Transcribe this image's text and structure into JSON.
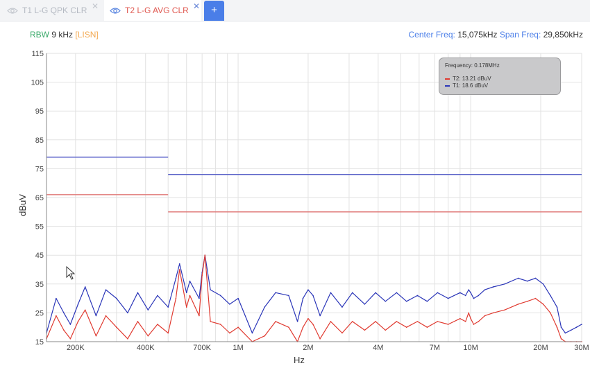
{
  "tabs": [
    {
      "label": "T1 L-G QPK CLR",
      "active": false
    },
    {
      "label": "T2 L-G AVG CLR",
      "active": true
    }
  ],
  "add_tab_label": "+",
  "close_glyph": "✕",
  "header": {
    "rbw_label": "RBW",
    "rbw_value": "9 kHz",
    "lisn_open": "[",
    "lisn_label": "LISN",
    "lisn_close": "]",
    "center_label": "Center Freq:",
    "center_value": "15,075kHz",
    "span_label": "Span Freq:",
    "span_value": "29,850kHz"
  },
  "legend": {
    "frequency_label": "Frequency: 0.178MHz",
    "entries": [
      {
        "label": "T2: 13.21 dBuV",
        "color": "#e03a30"
      },
      {
        "label": "T1: 18.6 dBuV",
        "color": "#2a35b8"
      }
    ]
  },
  "colors": {
    "t1": "#2a35b8",
    "t2": "#e03a30",
    "limit_t1": "#5a62c8",
    "limit_t2": "#e07a78",
    "accent": "#4a7ee8",
    "grid": "#e2e2e2"
  },
  "icons": {
    "tab_visibility": "eye-icon",
    "tab_close": "close-icon",
    "pointer": "cursor-icon"
  },
  "chart_data": {
    "type": "line",
    "xlabel": "Hz",
    "ylabel": "dBuV",
    "x_scale": "log",
    "xlim": [
      150000,
      30000000
    ],
    "ylim": [
      15,
      115
    ],
    "grid": true,
    "legend_position": "top-right",
    "y_ticks": [
      15,
      25,
      35,
      45,
      55,
      65,
      75,
      85,
      95,
      105,
      115
    ],
    "x_ticks": [
      {
        "value": 200000,
        "label": "200K"
      },
      {
        "value": 400000,
        "label": "400K"
      },
      {
        "value": 700000,
        "label": "700K"
      },
      {
        "value": 1000000,
        "label": "1M"
      },
      {
        "value": 2000000,
        "label": "2M"
      },
      {
        "value": 4000000,
        "label": "4M"
      },
      {
        "value": 7000000,
        "label": "7M"
      },
      {
        "value": 10000000,
        "label": "10M"
      },
      {
        "value": 20000000,
        "label": "20M"
      },
      {
        "value": 30000000,
        "label": "30M"
      }
    ],
    "limit_lines": [
      {
        "trace": "T1",
        "segments": [
          {
            "x": [
              150000,
              500000
            ],
            "y": [
              79,
              79
            ]
          },
          {
            "x": [
              500000,
              30000000
            ],
            "y": [
              73,
              73
            ]
          }
        ]
      },
      {
        "trace": "T2",
        "segments": [
          {
            "x": [
              150000,
              500000
            ],
            "y": [
              66,
              66
            ]
          },
          {
            "x": [
              500000,
              30000000
            ],
            "y": [
              60,
              60
            ]
          }
        ]
      }
    ],
    "series": [
      {
        "name": "T1",
        "x": [
          150000,
          165000,
          178000,
          190000,
          205000,
          220000,
          245000,
          270000,
          300000,
          335000,
          370000,
          410000,
          450000,
          500000,
          540000,
          560000,
          600000,
          620000,
          680000,
          700000,
          720000,
          760000,
          840000,
          920000,
          1000000,
          1150000,
          1300000,
          1450000,
          1650000,
          1800000,
          1900000,
          2000000,
          2100000,
          2250000,
          2500000,
          2800000,
          3100000,
          3500000,
          3900000,
          4300000,
          4800000,
          5300000,
          5900000,
          6500000,
          7200000,
          8000000,
          9000000,
          9500000,
          9800000,
          10000000,
          10300000,
          10800000,
          11500000,
          12500000,
          14000000,
          16000000,
          17500000,
          19000000,
          20500000,
          22000000,
          23500000,
          24500000,
          25500000,
          27000000,
          28500000,
          30000000
        ],
        "y": [
          18,
          30,
          25,
          21,
          28,
          34,
          24,
          33,
          30,
          25,
          32,
          26,
          31,
          27,
          37,
          42,
          32,
          36,
          30,
          39,
          45,
          33,
          31,
          28,
          30,
          18,
          27,
          32,
          31,
          22,
          30,
          33,
          31,
          24,
          32,
          27,
          32,
          28,
          32,
          29,
          32,
          29,
          31,
          29,
          32,
          30,
          32,
          31,
          33,
          32,
          30,
          31,
          33,
          34,
          35,
          37,
          36,
          37,
          35,
          31,
          27,
          20,
          18,
          19,
          20,
          21
        ]
      },
      {
        "name": "T2",
        "x": [
          150000,
          165000,
          178000,
          190000,
          205000,
          220000,
          245000,
          270000,
          300000,
          335000,
          370000,
          410000,
          450000,
          500000,
          540000,
          560000,
          600000,
          620000,
          680000,
          700000,
          720000,
          760000,
          840000,
          920000,
          1000000,
          1150000,
          1300000,
          1450000,
          1650000,
          1800000,
          1900000,
          2000000,
          2100000,
          2250000,
          2500000,
          2800000,
          3100000,
          3500000,
          3900000,
          4300000,
          4800000,
          5300000,
          5900000,
          6500000,
          7200000,
          8000000,
          9000000,
          9500000,
          9800000,
          10000000,
          10300000,
          10800000,
          11500000,
          12500000,
          14000000,
          16000000,
          17500000,
          19000000,
          20500000,
          22000000,
          23500000,
          24500000,
          25500000,
          27000000,
          28500000,
          30000000
        ],
        "y": [
          16,
          24,
          19,
          16,
          22,
          26,
          17,
          24,
          20,
          16,
          22,
          17,
          21,
          18,
          30,
          40,
          27,
          31,
          24,
          38,
          45,
          22,
          21,
          18,
          20,
          15,
          17,
          22,
          20,
          15,
          20,
          23,
          21,
          16,
          22,
          18,
          22,
          19,
          22,
          19,
          22,
          20,
          22,
          20,
          22,
          21,
          23,
          22,
          25,
          23,
          21,
          22,
          24,
          25,
          26,
          28,
          29,
          30,
          28,
          25,
          20,
          16,
          15,
          15,
          15,
          15
        ]
      }
    ]
  }
}
